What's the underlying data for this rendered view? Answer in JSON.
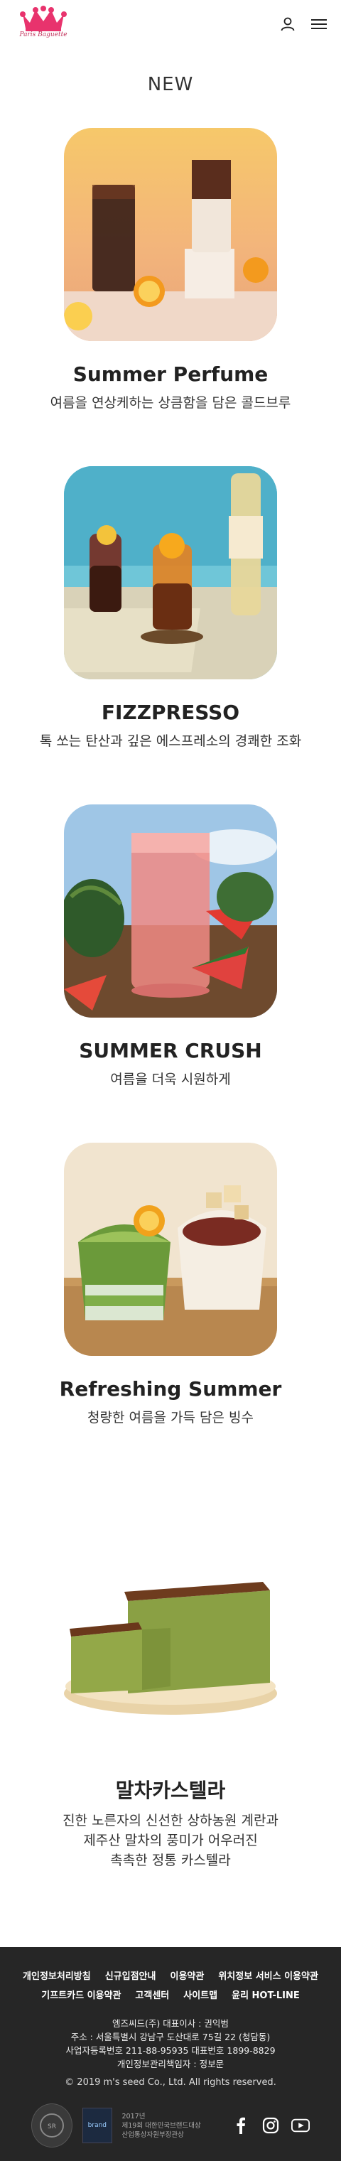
{
  "header": {
    "logo_text": "Paris Baguette"
  },
  "section_title": "NEW",
  "products": [
    {
      "name": "Summer Perfume",
      "desc": "여름을 연상케하는 상큼함을 담은 콜드브루"
    },
    {
      "name": "FIZZPRESSO",
      "desc": "톡 쏘는 탄산과 깊은 에스프레소의 경쾌한 조화"
    },
    {
      "name": "SUMMER CRUSH",
      "desc": "여름을 더욱 시원하게"
    },
    {
      "name": "Refreshing Summer",
      "desc": "청량한 여름을 가득 담은 빙수"
    },
    {
      "name": "말차카스텔라",
      "desc": "진한 노른자의 신선한 상하농원 계란과\n제주산 말차의 풍미가 어우러진\n촉촉한 정통 카스텔라"
    }
  ],
  "footer": {
    "links": [
      "개인정보처리방침",
      "신규입점안내",
      "이용약관",
      "위치정보 서비스 이용약관",
      "기프트카드 이용약관",
      "고객센터",
      "사이트맵",
      "윤리 HOT-LINE"
    ],
    "info": [
      "엠즈씨드(주) 대표이사 : 권익범",
      "주소 : 서울특별시 강남구 도산대로 75길 22 (청담동)",
      "사업자등록번호 211-88-95935 대표번호 1899-8829",
      "개인정보관리책임자 : 정보문"
    ],
    "copyright": "© 2019 m's seed Co., Ltd. All rights reserved.",
    "award": [
      "2017년",
      "제19회 대한민국브랜드대상",
      "산업통상자원부장관상"
    ],
    "badge_text": "brand"
  },
  "colors": {
    "footer_bg": "#262626",
    "logo_crown": "#e8336d"
  }
}
